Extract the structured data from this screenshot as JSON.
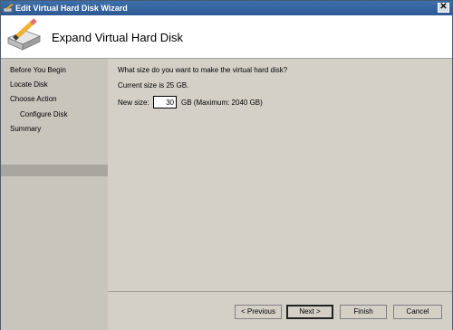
{
  "window": {
    "title": "Edit Virtual Hard Disk Wizard",
    "close_label": "✕"
  },
  "header": {
    "title": "Expand Virtual Hard Disk"
  },
  "sidebar": {
    "items": [
      {
        "label": "Before You Begin"
      },
      {
        "label": "Locate Disk"
      },
      {
        "label": "Choose Action"
      },
      {
        "label": "Configure Disk"
      },
      {
        "label": "Summary"
      }
    ]
  },
  "main": {
    "question": "What size do you want to make the virtual hard disk?",
    "current_size": "Current size is 25 GB.",
    "new_size_label": "New size:",
    "new_size_value": "30",
    "new_size_suffix": "GB (Maximum: 2040 GB)"
  },
  "buttons": {
    "previous": "< Previous",
    "next": "Next >",
    "finish": "Finish",
    "cancel": "Cancel"
  }
}
